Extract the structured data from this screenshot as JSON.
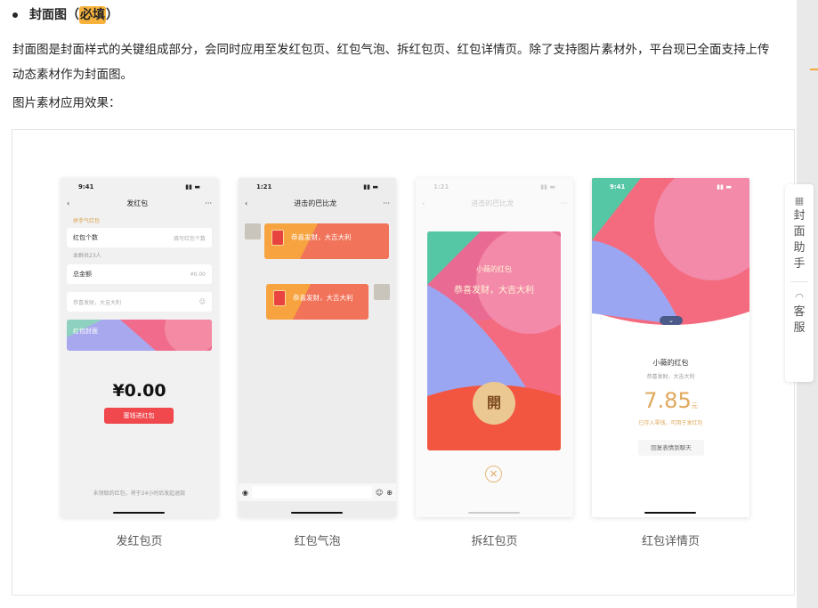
{
  "section": {
    "title_main": "封面图（",
    "title_highlight": "必填",
    "title_end": "）",
    "paragraph": "封面图是封面样式的关键组成部分，会同时应用至发红包页、红包气泡、拆红包页、红包详情页。除了支持图片素材外，平台现已全面支持上传动态素材作为封面图。",
    "subheading": "图片素材应用效果："
  },
  "phones": [
    {
      "caption": "发红包页",
      "time": "9:41",
      "nav_title": "发红包",
      "type_link": "拼手气红包",
      "count_label": "红包个数",
      "count_placeholder": "填写红包个数",
      "count_note": "本群共23人",
      "total_label": "总金额",
      "total_value": "¥0.00",
      "wish_placeholder": "恭喜发财，大吉大利",
      "cover_label": "红包封面",
      "amount": "¥0.00",
      "button": "塞钱进红包",
      "footer": "未领取的红包，将于24小时后发起退款"
    },
    {
      "caption": "红包气泡",
      "time": "1:21",
      "nav_title": "进击的巴比龙",
      "bubble_text_1": "恭喜发财，大吉大利",
      "bubble_text_2": "恭喜发财，大吉大利"
    },
    {
      "caption": "拆红包页",
      "time": "1:21",
      "nav_title": "进击的巴比龙",
      "sender": "小薇的红包",
      "wish": "恭喜发财，大吉大利",
      "open": "開"
    },
    {
      "caption": "红包详情页",
      "time": "9:41",
      "sender": "小薇的红包",
      "wish": "恭喜发财，大吉大利",
      "amount": "7.85",
      "unit": "元",
      "note": "已存入零钱，可用于发红包",
      "reply": "回复表情到聊天"
    }
  ],
  "assistant": {
    "label": "封面助手",
    "service": "客服"
  },
  "colors": {
    "highlight": "#f7b23b",
    "red": "#f0484d",
    "gold": "#e0a85d"
  }
}
